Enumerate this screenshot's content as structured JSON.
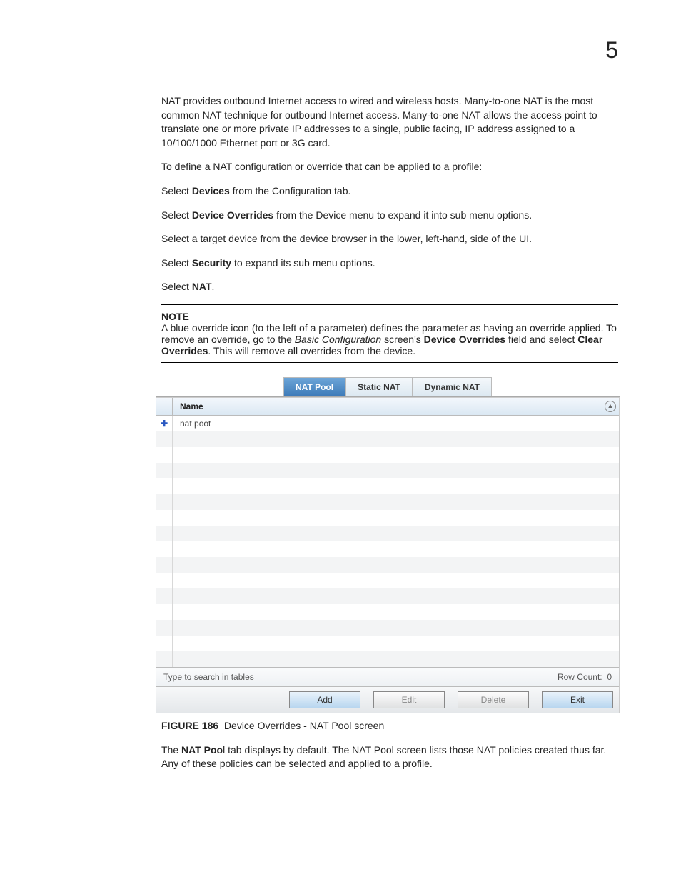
{
  "chapter_number": "5",
  "body": {
    "p1": "NAT provides outbound Internet access to wired and wireless hosts. Many-to-one NAT is the most common NAT technique for outbound Internet access. Many-to-one NAT allows the access point to translate one or more private IP addresses to a single, public facing, IP address assigned to a 10/100/1000 Ethernet port or 3G card.",
    "p2": "To define a NAT configuration or override that can be applied to a profile:",
    "step1_a": "Select ",
    "step1_b": "Devices",
    "step1_c": " from the Configuration tab.",
    "step2_a": "Select ",
    "step2_b": "Device Overrides",
    "step2_c": " from the Device menu to expand it into sub menu options.",
    "step3": "Select a target device from the device browser in the lower, left-hand, side of the UI.",
    "step4_a": "Select ",
    "step4_b": "Security",
    "step4_c": " to expand its sub menu options.",
    "step5_a": "Select ",
    "step5_b": "NAT",
    "step5_c": "."
  },
  "note": {
    "heading": "NOTE",
    "t1": "A blue override icon (to the left of a parameter) defines the parameter as having an override applied. To remove an override, go to the ",
    "t2": "Basic Configuration",
    "t3": " screen's ",
    "t4": "Device Overrides",
    "t5": " field and select ",
    "t6": "Clear Overrides",
    "t7": ". This will remove all overrides from the device."
  },
  "screenshot": {
    "tabs": {
      "natpool": "NAT Pool",
      "staticnat": "Static NAT",
      "dynamicnat": "Dynamic NAT"
    },
    "table": {
      "header_name": "Name",
      "row1_name": "nat poot",
      "search_placeholder": "Type to search in tables",
      "rowcount_label": "Row Count:",
      "rowcount_value": "0"
    },
    "buttons": {
      "add": "Add",
      "edit": "Edit",
      "delete": "Delete",
      "exit": "Exit"
    }
  },
  "figure": {
    "label": "FIGURE 186",
    "caption": "Device Overrides - NAT Pool screen"
  },
  "trailing": {
    "t1": "The ",
    "t2": "NAT Poo",
    "t3": "l tab displays by default. The NAT Pool screen lists those NAT policies created thus far. Any of these policies can be selected and applied to a profile."
  }
}
